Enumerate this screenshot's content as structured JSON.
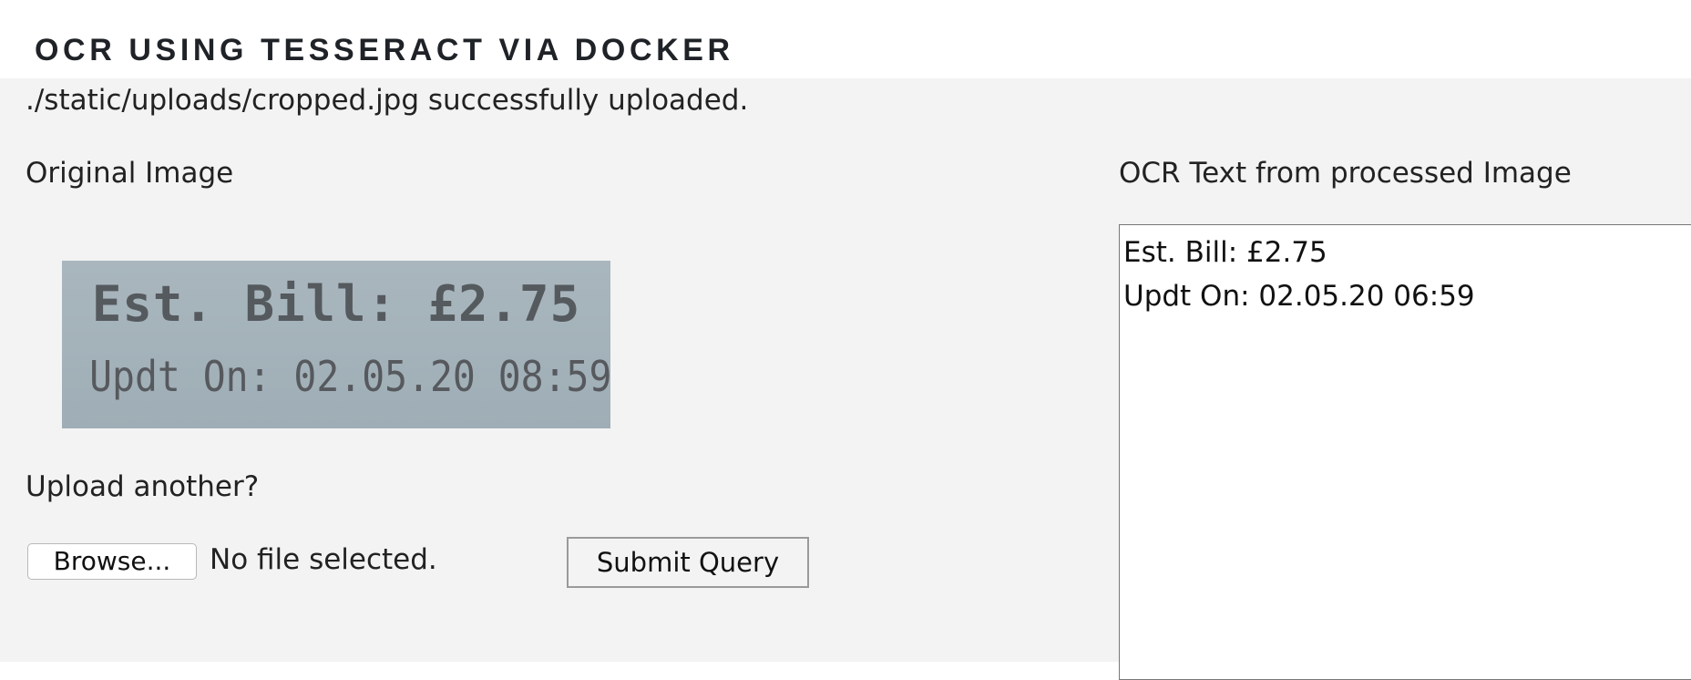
{
  "header": {
    "title": "OCR USING TESSERACT VIA DOCKER"
  },
  "status": {
    "message": "./static/uploads/cropped.jpg successfully uploaded."
  },
  "original": {
    "heading": "Original Image",
    "image_text": {
      "line1": "Est. Bill: £2.75",
      "line2": "Updt On: 02.05.20 08:59"
    }
  },
  "upload": {
    "heading": "Upload another?",
    "browse_label": "Browse...",
    "file_status": "No file selected.",
    "submit_label": "Submit Query"
  },
  "ocr": {
    "heading": "OCR Text from processed Image",
    "text": "Est. Bill: £2.75\nUpdt On: 02.05.20 06:59"
  }
}
